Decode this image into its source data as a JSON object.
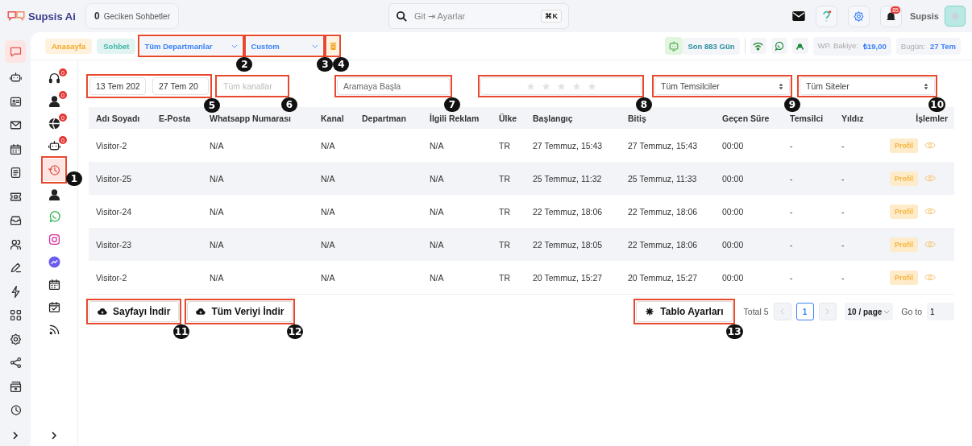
{
  "topbar": {
    "brand": "Supsis Ai",
    "overdue": {
      "count": "0",
      "label": "Geciken Sohbetler"
    },
    "search": {
      "placeholder": "Git ⇥ Ayarlar",
      "shortcut": "⌘K"
    },
    "notifications": "85",
    "user": "Supsis"
  },
  "rail": [
    {
      "selected": true
    },
    {
      "selected": false
    },
    {
      "selected": false
    },
    {
      "selected": false
    },
    {
      "selected": false
    },
    {
      "selected": false
    },
    {
      "selected": false
    },
    {
      "selected": false
    },
    {
      "selected": false
    },
    {
      "selected": false
    },
    {
      "selected": false
    },
    {
      "selected": false
    },
    {
      "selected": false
    },
    {
      "selected": false
    },
    {
      "selected": false
    },
    {
      "selected": false
    }
  ],
  "subbar": {
    "breadcrumbs": [
      {
        "label": "Anasayfa",
        "color": "#f5a623"
      },
      {
        "label": "Sohbet",
        "color": "#3fb7a6"
      }
    ],
    "department": {
      "value": "Tüm Departmanlar",
      "callout": "2"
    },
    "range": {
      "value": "Custom",
      "callout": "3"
    },
    "clear_callout": "4",
    "days": "Son 883 Gün",
    "balance_label": "WP. Bakiye:",
    "balance": "₺19,00",
    "today_label": "Bugün:",
    "today": "27 Tem"
  },
  "subrail": [
    {
      "badge": "0",
      "selected": false
    },
    {
      "badge": "0",
      "selected": false
    },
    {
      "badge": "0",
      "selected": false
    },
    {
      "badge": "0",
      "selected": false
    },
    {
      "selected": true,
      "callout": "1"
    },
    {
      "selected": false
    },
    {
      "selected": false
    },
    {
      "selected": false
    },
    {
      "selected": false
    },
    {
      "selected": false
    },
    {
      "selected": false
    },
    {
      "selected": false
    }
  ],
  "filters": {
    "date_from": "13 Tem 202",
    "date_to": "27 Tem 20",
    "date_callout": "5",
    "channel": {
      "placeholder": "Tüm kanallar",
      "callout": "6"
    },
    "search": {
      "placeholder": "Aramaya Başla",
      "callout": "7"
    },
    "rating": {
      "stars": 0,
      "callout": "8"
    },
    "agents": {
      "value": "Tüm Temsilciler",
      "callout": "9"
    },
    "sites": {
      "value": "Tüm Siteler",
      "callout": "10"
    }
  },
  "table": {
    "columns": [
      "Adı Soyadı",
      "E-Posta",
      "Whatsapp Numarası",
      "Kanal",
      "Departman",
      "İlgili Reklam",
      "Ülke",
      "Başlangıç",
      "Bitiş",
      "Geçen Süre",
      "Temsilci",
      "Yıldız",
      "İşlemler"
    ],
    "rows": [
      {
        "cells": [
          "Visitor-2",
          "",
          "N/A",
          "N/A",
          "",
          "N/A",
          "TR",
          "27 Temmuz, 15:43",
          "27 Temmuz, 15:43",
          "00:00",
          "-",
          "-"
        ],
        "action": "Profil"
      },
      {
        "cells": [
          "Visitor-25",
          "",
          "N/A",
          "N/A",
          "",
          "N/A",
          "TR",
          "25 Temmuz, 11:32",
          "25 Temmuz, 11:33",
          "00:00",
          "-",
          "-"
        ],
        "action": "Profil"
      },
      {
        "cells": [
          "Visitor-24",
          "",
          "N/A",
          "N/A",
          "",
          "N/A",
          "TR",
          "22 Temmuz, 18:06",
          "22 Temmuz, 18:06",
          "00:00",
          "-",
          "-"
        ],
        "action": "Profil"
      },
      {
        "cells": [
          "Visitor-23",
          "",
          "N/A",
          "N/A",
          "",
          "N/A",
          "TR",
          "22 Temmuz, 18:05",
          "22 Temmuz, 18:06",
          "00:00",
          "-",
          "-"
        ],
        "action": "Profil"
      },
      {
        "cells": [
          "Visitor-2",
          "",
          "N/A",
          "N/A",
          "",
          "N/A",
          "TR",
          "20 Temmuz, 15:27",
          "20 Temmuz, 15:27",
          "00:00",
          "-",
          "-"
        ],
        "action": "Profil"
      }
    ]
  },
  "footer": {
    "buttons": [
      {
        "label": "Sayfayı İndir",
        "callout": "11"
      },
      {
        "label": "Tüm Veriyi İndir",
        "callout": "12"
      }
    ],
    "settings": {
      "label": "Tablo Ayarları",
      "callout": "13"
    },
    "total": "Total 5",
    "pages": [
      {
        "label": "1",
        "selected": true
      }
    ],
    "page_size": "10 / page",
    "goto_label": "Go to",
    "goto_value": "1"
  }
}
